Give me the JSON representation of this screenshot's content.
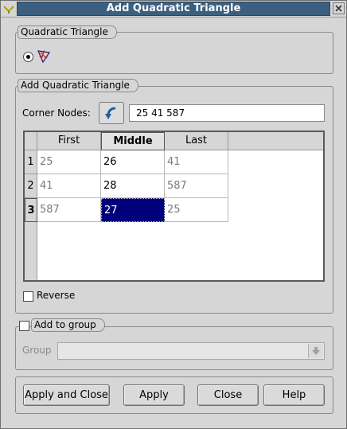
{
  "window": {
    "title": "Add Quadratic Triangle"
  },
  "type_group": {
    "title": "Quadratic Triangle",
    "option_icon": "quadratic-triangle-icon"
  },
  "arguments_group": {
    "title": "Add Quadratic Triangle",
    "corner_nodes_label": "Corner Nodes:",
    "corner_nodes_value": "25 41 587",
    "selection_icon": "select-arrow-icon",
    "table": {
      "columns": [
        "First",
        "Middle",
        "Last"
      ],
      "active_column": 1,
      "rows": [
        {
          "label": "1",
          "cells": [
            "25",
            "26",
            "41"
          ]
        },
        {
          "label": "2",
          "cells": [
            "41",
            "28",
            "587"
          ]
        },
        {
          "label": "3",
          "cells": [
            "587",
            "27",
            "25"
          ]
        }
      ],
      "active_row": 2,
      "selected_cell": "27"
    },
    "reverse_label": "Reverse",
    "reverse_checked": false
  },
  "group_section": {
    "title": "Add to group",
    "checked": false,
    "group_label": "Group",
    "group_value": ""
  },
  "buttons": {
    "apply_and_close": "Apply and Close",
    "apply": "Apply",
    "close": "Close",
    "help": "Help"
  },
  "colors": {
    "titlebar": "#3b5f7f",
    "selection": "#00007a",
    "dialog_bg": "#d6d6d6"
  }
}
